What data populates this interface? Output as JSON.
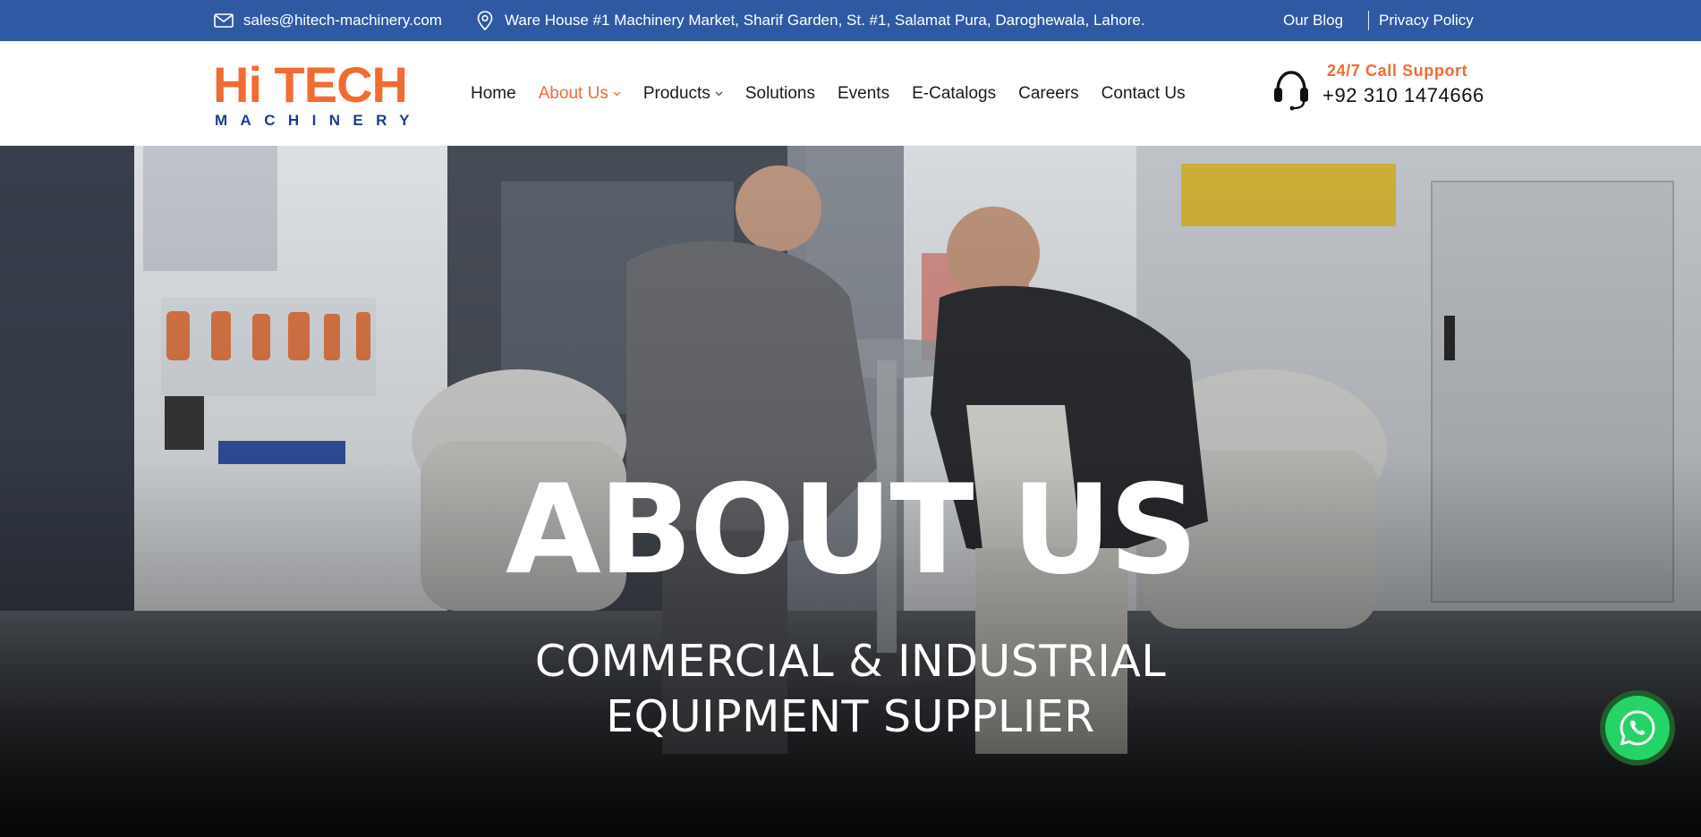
{
  "topbar": {
    "email": "sales@hitech-machinery.com",
    "address": "Ware House #1 Machinery Market, Sharif Garden, St. #1, Salamat Pura, Daroghewala, Lahore.",
    "links": [
      "Our Blog",
      "Privacy Policy"
    ],
    "email_icon": "mail-icon",
    "address_icon": "location-pin-icon"
  },
  "logo": {
    "main": "Hi TECH",
    "sub": "MACHINERY"
  },
  "nav": {
    "items": [
      {
        "label": "Home",
        "active": false,
        "dropdown": false
      },
      {
        "label": "About Us",
        "active": true,
        "dropdown": true
      },
      {
        "label": "Products",
        "active": false,
        "dropdown": true
      },
      {
        "label": "Solutions",
        "active": false,
        "dropdown": false
      },
      {
        "label": "Events",
        "active": false,
        "dropdown": false
      },
      {
        "label": "E-Catalogs",
        "active": false,
        "dropdown": false
      },
      {
        "label": "Careers",
        "active": false,
        "dropdown": false
      },
      {
        "label": "Contact Us",
        "active": false,
        "dropdown": false
      }
    ]
  },
  "support": {
    "label": "24/7 Call Support",
    "phone": "+92 310 1474666",
    "icon": "headset-icon"
  },
  "hero": {
    "title": "ABOUT US",
    "subtitle_line1": "COMMERCIAL & INDUSTRIAL",
    "subtitle_line2": "EQUIPMENT SUPPLIER"
  },
  "floating": {
    "icon": "whatsapp-icon"
  },
  "colors": {
    "topbar_bg": "#2f5aa3",
    "brand_orange": "#f26b32",
    "brand_blue": "#1d3f8f",
    "whatsapp_green": "#25d366"
  }
}
